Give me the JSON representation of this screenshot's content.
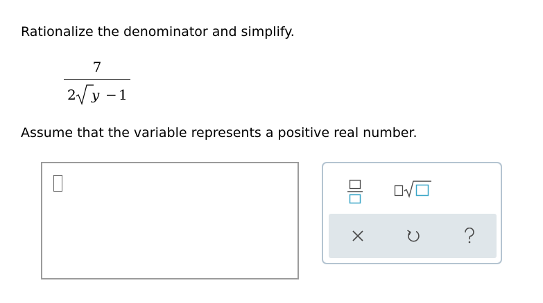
{
  "question": {
    "instruction": "Rationalize the denominator and simplify.",
    "expression": {
      "numerator": "7",
      "denominator": {
        "coefficient": "2",
        "radicand": "y",
        "operator": "−",
        "constant": "1"
      }
    },
    "assumption": "Assume that the variable represents a positive real number."
  },
  "answer": {
    "value": ""
  },
  "palette": {
    "tools": [
      {
        "name": "fraction",
        "icon": "fraction-icon"
      },
      {
        "name": "square-root",
        "icon": "square-root-icon"
      }
    ],
    "actions": [
      {
        "name": "clear",
        "icon": "close-icon"
      },
      {
        "name": "undo",
        "icon": "undo-icon"
      },
      {
        "name": "help",
        "icon": "question-mark-icon"
      }
    ]
  },
  "colors": {
    "accent": "#3aa6c7",
    "panel_border": "#b4c4d1",
    "action_bar": "#dfe6ea",
    "answer_border": "#9b9b9b",
    "icon_gray": "#4a4a4a"
  }
}
